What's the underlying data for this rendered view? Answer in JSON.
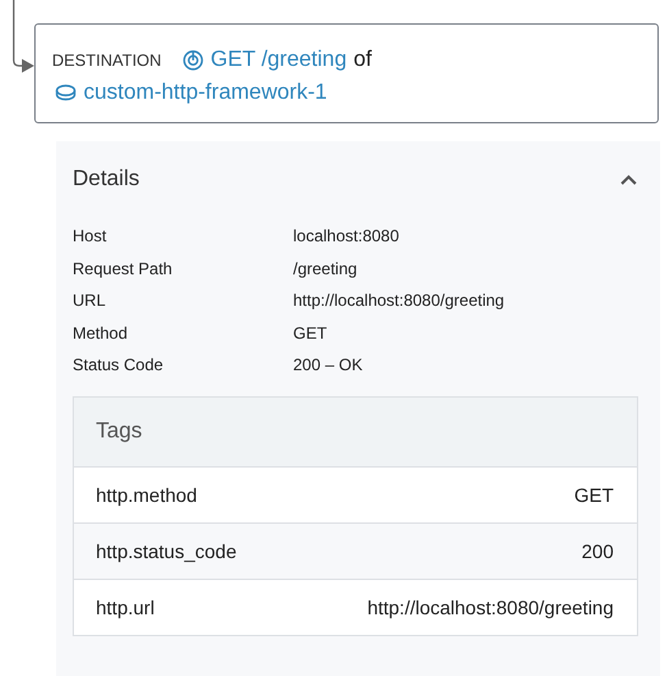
{
  "destination": {
    "label": "DESTINATION",
    "endpoint": "GET /greeting",
    "joiner": "of",
    "service": "custom-http-framework-1"
  },
  "details": {
    "title": "Details",
    "expanded": true,
    "rows": [
      {
        "key": "Host",
        "value": "localhost:8080"
      },
      {
        "key": "Request Path",
        "value": "/greeting"
      },
      {
        "key": "URL",
        "value": "http://localhost:8080/greeting"
      },
      {
        "key": "Method",
        "value": "GET"
      },
      {
        "key": "Status Code",
        "value": "200 – OK"
      }
    ]
  },
  "tags": {
    "title": "Tags",
    "rows": [
      {
        "key": "http.method",
        "value": "GET"
      },
      {
        "key": "http.status_code",
        "value": "200"
      },
      {
        "key": "http.url",
        "value": "http://localhost:8080/greeting"
      }
    ]
  }
}
